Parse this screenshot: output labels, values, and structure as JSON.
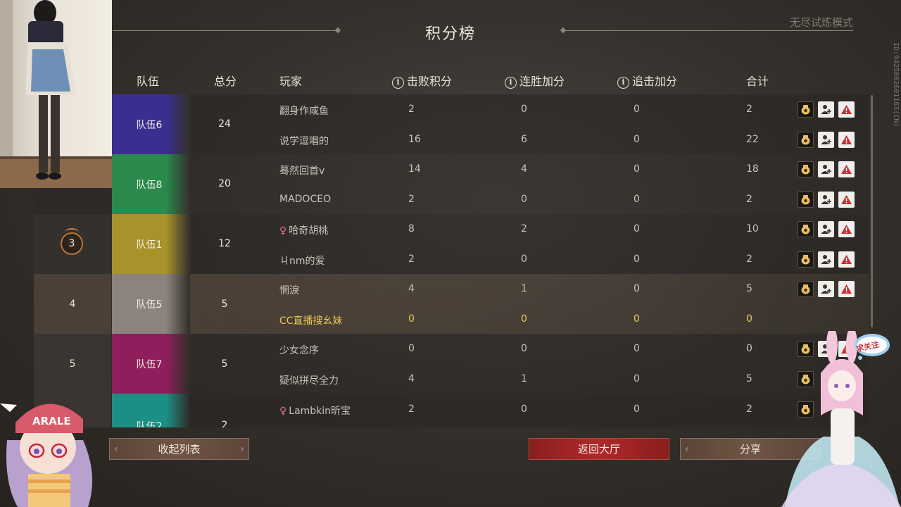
{
  "title": "积分榜",
  "mode": "无尽试炼模式",
  "session_id": "ID:9425002601163(CN)",
  "headers": {
    "team": "队伍",
    "total": "总分",
    "player": "玩家",
    "defeat": "击败积分",
    "streak": "连胜加分",
    "chase": "追击加分",
    "sum": "合计"
  },
  "ranks": {
    "r3": "3",
    "r4": "4",
    "r5": "5"
  },
  "teams": [
    {
      "name": "队伍6",
      "score": "24"
    },
    {
      "name": "队伍8",
      "score": "20"
    },
    {
      "name": "队伍1",
      "score": "12"
    },
    {
      "name": "队伍5",
      "score": "5"
    },
    {
      "name": "队伍7",
      "score": "5"
    },
    {
      "name": "队伍2",
      "score": "2"
    }
  ],
  "players": [
    {
      "name": "翻身作咸鱼",
      "defeat": "2",
      "streak": "0",
      "chase": "0",
      "total": "2"
    },
    {
      "name": "说学逗唱的",
      "defeat": "16",
      "streak": "6",
      "chase": "0",
      "total": "22"
    },
    {
      "name": "蓦然回首v",
      "defeat": "14",
      "streak": "4",
      "chase": "0",
      "total": "18"
    },
    {
      "name": "MADOCEO",
      "defeat": "2",
      "streak": "0",
      "chase": "0",
      "total": "2"
    },
    {
      "name": "哈奇胡桃",
      "female": "♀",
      "defeat": "8",
      "streak": "2",
      "chase": "0",
      "total": "10"
    },
    {
      "name": "ㄐnm的爱",
      "defeat": "2",
      "streak": "0",
      "chase": "0",
      "total": "2"
    },
    {
      "name": "惘淚",
      "defeat": "4",
      "streak": "1",
      "chase": "0",
      "total": "5"
    },
    {
      "name": "CC直播搜幺妹",
      "defeat": "0",
      "streak": "0",
      "chase": "0",
      "total": "0"
    },
    {
      "name": "少女念序",
      "defeat": "0",
      "streak": "0",
      "chase": "0",
      "total": "0"
    },
    {
      "name": "疑似拼尽全力",
      "defeat": "4",
      "streak": "1",
      "chase": "0",
      "total": "5"
    },
    {
      "name": "Lambkin昕宝",
      "female": "♀",
      "defeat": "2",
      "streak": "0",
      "chase": "0",
      "total": "2"
    }
  ],
  "buttons": {
    "collapse": "收起列表",
    "back": "返回大厅",
    "share": "分享"
  },
  "overlay": {
    "follow_bubble": "求关注",
    "cap_text": "ARALE"
  },
  "colors": {
    "team6": "#3a2f8f",
    "team8": "#2a8a4e",
    "team1": "#a8922a",
    "team5": "#8a847c",
    "team7": "#8f1f5c",
    "team2": "#1c8f85",
    "highlight": "#e8c85a",
    "back_button": "#b02828"
  },
  "icons": [
    "info-icon",
    "bean-bag-icon",
    "add-friend-icon",
    "report-warning-icon"
  ]
}
